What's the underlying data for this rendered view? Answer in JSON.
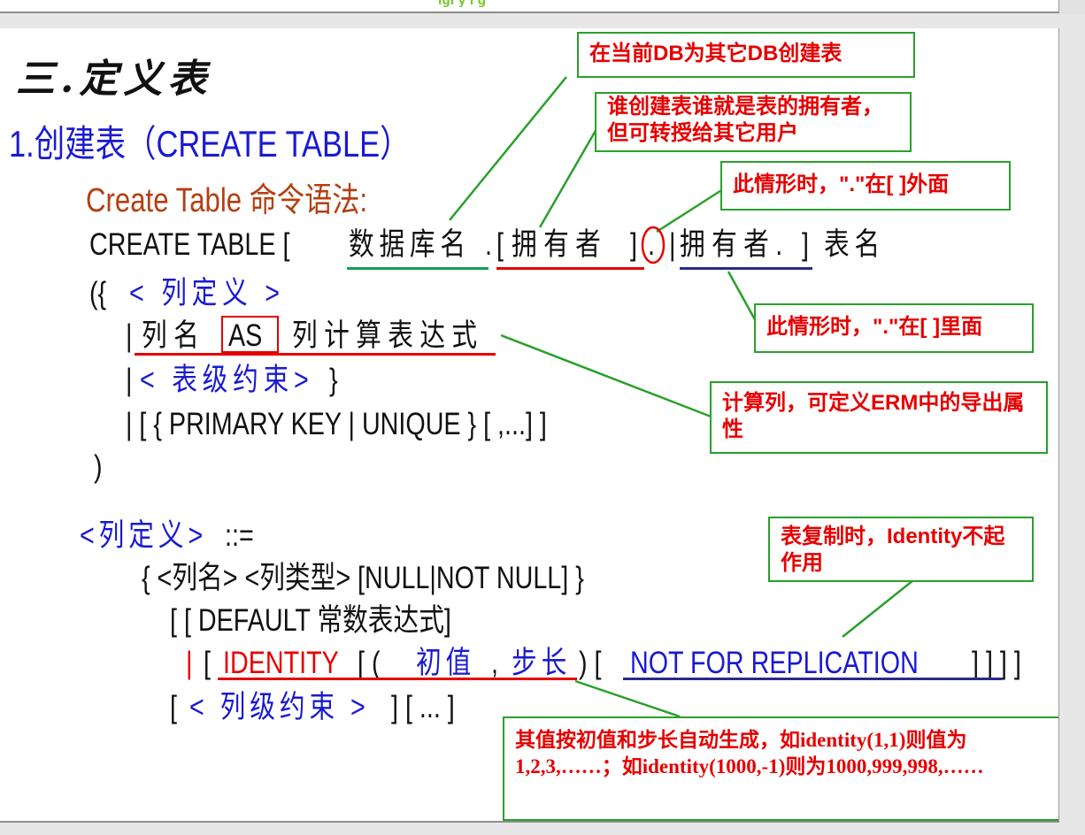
{
  "header": {
    "tagline": "igi  y   i g"
  },
  "slide": {
    "section_title": "三.定义表",
    "subtitle": "1.创建表（CREATE  TABLE）",
    "syntax_label": "Create Table 命令语法:",
    "line1": {
      "prefix": "CREATE TABLE  [",
      "db_name": "数据库名",
      "dot1": ".",
      "bracket_open": "[",
      "owner1": "拥有者",
      "bracket_close": "]",
      "dot2": ".",
      "bar": "|",
      "owner2": "拥有者.",
      "bracket_close2": "]",
      "table_name": "表名"
    },
    "line2": {
      "open": "({",
      "column_def": "< 列定义 >"
    },
    "line3": {
      "bar": "|",
      "col_name": "列名",
      "as_kw": "AS",
      "expr": "列计算表达式"
    },
    "line4": {
      "bar": "|",
      "table_constraint": "< 表级约束>",
      "close": "}"
    },
    "line5": "| [ { PRIMARY KEY | UNIQUE } [ ,...] ]",
    "line6": ")",
    "def_heading": {
      "col_def": "<列定义>",
      "assign": "::="
    },
    "def_line1": "{ <列名> <列类型> [NULL|NOT NULL] }",
    "def_line2": "[ [ DEFAULT 常数表达式]",
    "def_line3": {
      "bar": "|",
      "open": "[",
      "identity": "IDENTITY",
      "paren_open": "[ (",
      "seed": "初值",
      "comma": ",",
      "step": "步长",
      "paren_close": ") [",
      "nfr": "NOT FOR REPLICATION",
      "close": "] ] ] ]"
    },
    "def_line4": {
      "open": "[",
      "col_constraint": "< 列级约束 >",
      "rest": "] [ ... ]"
    }
  },
  "callouts": {
    "create_other_db": "在当前DB为其它DB创建表",
    "owner_note": "谁创建表谁就是表的拥有者，但可转授给其它用户",
    "dot_outside": "此情形时，\".\"在[ ]外面",
    "dot_inside": "此情形时，\".\"在[ ]里面",
    "computed_column": "计算列，可定义ERM中的导出属性",
    "identity_copy": "表复制时，Identity不起作用",
    "identity_note": "其值按初值和步长自动生成，如identity(1,1)则值为1,2,3,……；如identity(1000,-1)则为1000,999,998,……"
  },
  "colors": {
    "blue_text": "#1a1ad0",
    "red_text": "#e60000",
    "label_brown": "#b33f12",
    "callout_border": "#2aa02a",
    "db_underline": "#14a05a",
    "owner_underline": "#e60000",
    "owner2_underline": "#2a2a8a"
  }
}
